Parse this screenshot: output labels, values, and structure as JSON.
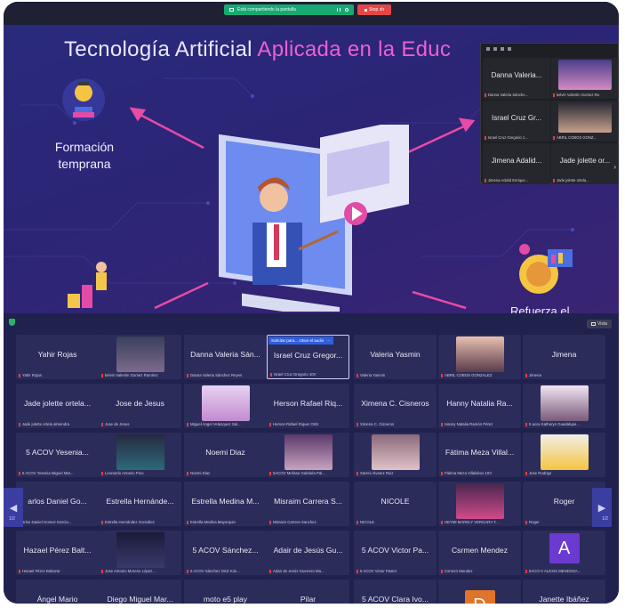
{
  "share_toolbar": {
    "sharing_label": "Está compartiendo la pantalla",
    "stop_label": "Stop sh"
  },
  "slide": {
    "title_part1": "Tecnología Artificial ",
    "title_part2": "Aplicada en la Educ",
    "left_label_line1": "Formación",
    "left_label_line2": "temprana",
    "right_label": "Refuerza el",
    "colors": {
      "accent_pink": "#ee5fd2",
      "arrow": "#e84aa6"
    }
  },
  "video_panel": {
    "cells": [
      {
        "name": "Danna Valeria...",
        "sub": "Danna Valeria Sánche..."
      },
      {
        "name": "",
        "sub": "kelvin Valentin Gomez Ra"
      },
      {
        "name": "Israel Cruz Gr...",
        "sub": "Israel Cruz Gregorio 1..."
      },
      {
        "name": "",
        "sub": "ABRIL COBOS GONZ..."
      },
      {
        "name": "Jimena Adalid...",
        "sub": "Jimena Adalid Enrique..."
      },
      {
        "name": "Jade jolette or...",
        "sub": "Jade jolette ortela..."
      }
    ]
  },
  "gallery": {
    "view_label": "Vista",
    "page_left": "1/2",
    "page_right": "1/2",
    "highlight_tip": "Solicitar para... cttvar el audio",
    "tiles": [
      {
        "name": "Yahir Rojas",
        "sub": "Yahir Rojas"
      },
      {
        "name": "",
        "sub": "kelvin Valentin Gomez Ramirez"
      },
      {
        "name": "Danna Valeria Sán...",
        "sub": "Danna Valeria Sánchez Reyes"
      },
      {
        "name": "Israel Cruz Gregor...",
        "sub": "Israel Cruz Gregorio 10V"
      },
      {
        "name": "Valeria Yasmin",
        "sub": "Valeria Yasmin"
      },
      {
        "name": "",
        "sub": "ABRIL COBOS GONZALEZ"
      },
      {
        "name": "Jimena",
        "sub": "Jimena"
      },
      {
        "name": "Jade jolette ortela...",
        "sub": "Jade jolette ortela almendra"
      },
      {
        "name": "Jose de Jesus",
        "sub": "Jose de Jesus"
      },
      {
        "name": "",
        "sub": "Miguel Angel Velazquez Sal..."
      },
      {
        "name": "Herson Rafael Riq...",
        "sub": "Herson Rafael Riquer Ortiz"
      },
      {
        "name": "Ximena C. Cisneros",
        "sub": "Ximena C. Cisneros"
      },
      {
        "name": "Hanny Natalia Ra...",
        "sub": "Hanny Natalia Ramón Pérez"
      },
      {
        "name": "",
        "sub": "5 acov Katheryn Guadalupe..."
      },
      {
        "name": "5 ACOV Yesenia...",
        "sub": "5 ACOV Yesenia Miguel Mar..."
      },
      {
        "name": "",
        "sub": "Leonardo Antonio Pino"
      },
      {
        "name": "Noemi Diaz",
        "sub": "Noemi Diaz"
      },
      {
        "name": "",
        "sub": "5ACOV Melissa Gabriela Pal..."
      },
      {
        "name": "",
        "sub": "Xareni Alvarez Ruiz"
      },
      {
        "name": "Fátima Meza Villal...",
        "sub": "Fátima Meza Villalobos 10V"
      },
      {
        "name": "",
        "sub": "Jose Rodrigo"
      },
      {
        "name": "arlos Daniel Go...",
        "sub": "arlos Daniel Gomez Garcia..."
      },
      {
        "name": "Estrella Hernánde...",
        "sub": "Estrella Hernández González"
      },
      {
        "name": "Estrella Medina M...",
        "sub": "Estrella Medina Mayorquin"
      },
      {
        "name": "Misraim Carrera S...",
        "sub": "Misraim Carrera Sanchez"
      },
      {
        "name": "NICOLE",
        "sub": "NICOLE"
      },
      {
        "name": "",
        "sub": "HEYMI MARELY VERGARA T..."
      },
      {
        "name": "Roger",
        "sub": "Roger"
      },
      {
        "name": "Hazael Pérez Balt...",
        "sub": "Hazael Pérez Baltazar"
      },
      {
        "name": "",
        "sub": "Jose Antonio Moreno López..."
      },
      {
        "name": "5 ACOV Sánchez...",
        "sub": "5 ACOV Sánchez Ortiz Kim..."
      },
      {
        "name": "Adair de Jesús Gu...",
        "sub": "Adair de Jesús Guerrero Ma..."
      },
      {
        "name": "5 ACOV Victor Pa...",
        "sub": "5 ACOV Victor Pastor"
      },
      {
        "name": "Csrmen Mendez",
        "sub": "Csrmen Mendez"
      },
      {
        "name": "",
        "sub": "5ACO-V ALEXIS MENDOZA..."
      },
      {
        "name": "Ángel Mario",
        "sub": ""
      },
      {
        "name": "Diego Miguel Mar...",
        "sub": ""
      },
      {
        "name": "moto e5 play",
        "sub": ""
      },
      {
        "name": "Pilar",
        "sub": ""
      },
      {
        "name": "5 ACOV Clara Ivo...",
        "sub": ""
      },
      {
        "name": "",
        "sub": ""
      },
      {
        "name": "Janette Ibáñez",
        "sub": ""
      }
    ],
    "avatar_letter_a": "A",
    "avatar_letter_d": "D"
  }
}
